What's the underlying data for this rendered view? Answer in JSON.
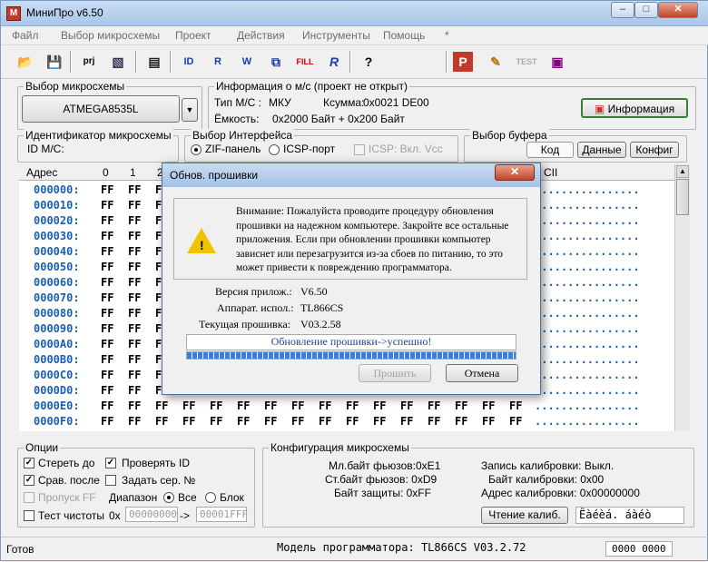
{
  "window": {
    "title": "МиниПро v6.50",
    "min": "–",
    "max": "□",
    "close": "✕"
  },
  "menu": [
    "Файл",
    "Выбор микросхемы",
    "Проект",
    "Действия",
    "Инструменты",
    "Помощь",
    "*"
  ],
  "toolbar": {
    "prj": "prj",
    "icons": [
      "open-icon",
      "save-icon",
      "project-icon",
      "pick-icon",
      "chip-icon",
      "read-id-icon",
      "read-icon",
      "write-icon",
      "verify-icon",
      "fill-icon",
      "blank-r-icon",
      "help-icon",
      "program-p-icon",
      "notepad-icon",
      "test-icon",
      "chip-test-icon"
    ]
  },
  "chip_select": {
    "legend": "Выбор микросхемы",
    "value": "ATMEGA8535L"
  },
  "chip_info": {
    "legend": "Информация о м/с (проект не открыт)",
    "type_label": "Тип М/С :",
    "type_value": "МКУ",
    "checksum_label": "Ксумма:",
    "checksum_value": "0x0021 DE00",
    "capacity_label": "Ёмкость:",
    "capacity_value": "0x2000 Байт  + 0x200 Байт",
    "info_button": "Информация"
  },
  "chip_id": {
    "legend": "Идентификатор микросхемы",
    "label": "ID M/C:"
  },
  "interface": {
    "legend": "Выбор Интерфейса",
    "zif": "ZIF-панель",
    "icsp": "ICSP-порт",
    "icsp_vcc": "ICSP: Вкл. Vcc"
  },
  "buffer": {
    "legend": "Выбор буфера",
    "tabs": [
      "Код",
      "Данные",
      "Конфиг"
    ]
  },
  "hex": {
    "header_addr": "Адрес",
    "header_cols": [
      "0",
      "1",
      "2"
    ],
    "header_ascii": "CII",
    "rows": [
      {
        "addr": "000000:"
      },
      {
        "addr": "000010:"
      },
      {
        "addr": "000020:"
      },
      {
        "addr": "000030:"
      },
      {
        "addr": "000040:"
      },
      {
        "addr": "000050:"
      },
      {
        "addr": "000060:"
      },
      {
        "addr": "000070:"
      },
      {
        "addr": "000080:"
      },
      {
        "addr": "000090:"
      },
      {
        "addr": "0000A0:"
      },
      {
        "addr": "0000B0:"
      },
      {
        "addr": "0000C0:"
      },
      {
        "addr": "0000D0:"
      },
      {
        "addr": "0000E0:"
      },
      {
        "addr": "0000F0:"
      }
    ],
    "byte": "FF",
    "ascii_dots": "................"
  },
  "options": {
    "legend": "Опции",
    "erase": "Стереть до",
    "check_id": "Проверять ID",
    "compare": "Срав. после",
    "set_serial": "Задать сер. №",
    "skip_ff": "Пропуск FF",
    "range_label": "Диапазон",
    "range_all": "Все",
    "range_block": "Блок",
    "blank_test": "Тест чистоты",
    "from_prefix": "0x",
    "from_value": "00000000",
    "arrow": "->",
    "to_value": "00001FFF"
  },
  "config": {
    "legend": "Конфигурация микросхемы",
    "low_fuse": "Мл.байт фьюзов:0xE1",
    "high_fuse": "Ст.байт фьюзов: 0xD9",
    "lock": "Байт защиты:    0xFF",
    "cal_write": "Запись калибровки: Выкл.",
    "cal_byte": "Байт калибровки: 0x00",
    "cal_addr": "Адрес калибровки:  0x00000000",
    "read_cal_button": "Чтение калиб.",
    "cal_field": "Ëàéèá. áàéò"
  },
  "status": {
    "ready": "Готов",
    "model": "Модель программатора:   TL866CS V03.2.72",
    "counter": "0000 0000"
  },
  "dialog": {
    "title": "Обнов. прошивки",
    "warning": "Внимание: Пожалуйста проводите процедуру обновления прошивки на надежном компьютере. Закройте все остальные приложения. Если при обновлении прошивки компьютер зависнет или перезагрузится из-за сбоев по питанию, то это может привести к повреждению программатора.",
    "app_version_label": "Версия прилож.:",
    "app_version": "V6.50",
    "hw_label": "Аппарат. испол.:",
    "hw": "TL866CS",
    "fw_label": "Текущая прошивка:",
    "fw": "V03.2.58",
    "status": "Обновление прошивки->успешно!",
    "progress": 1.0,
    "flash_button": "Прошить",
    "cancel_button": "Отмена"
  }
}
